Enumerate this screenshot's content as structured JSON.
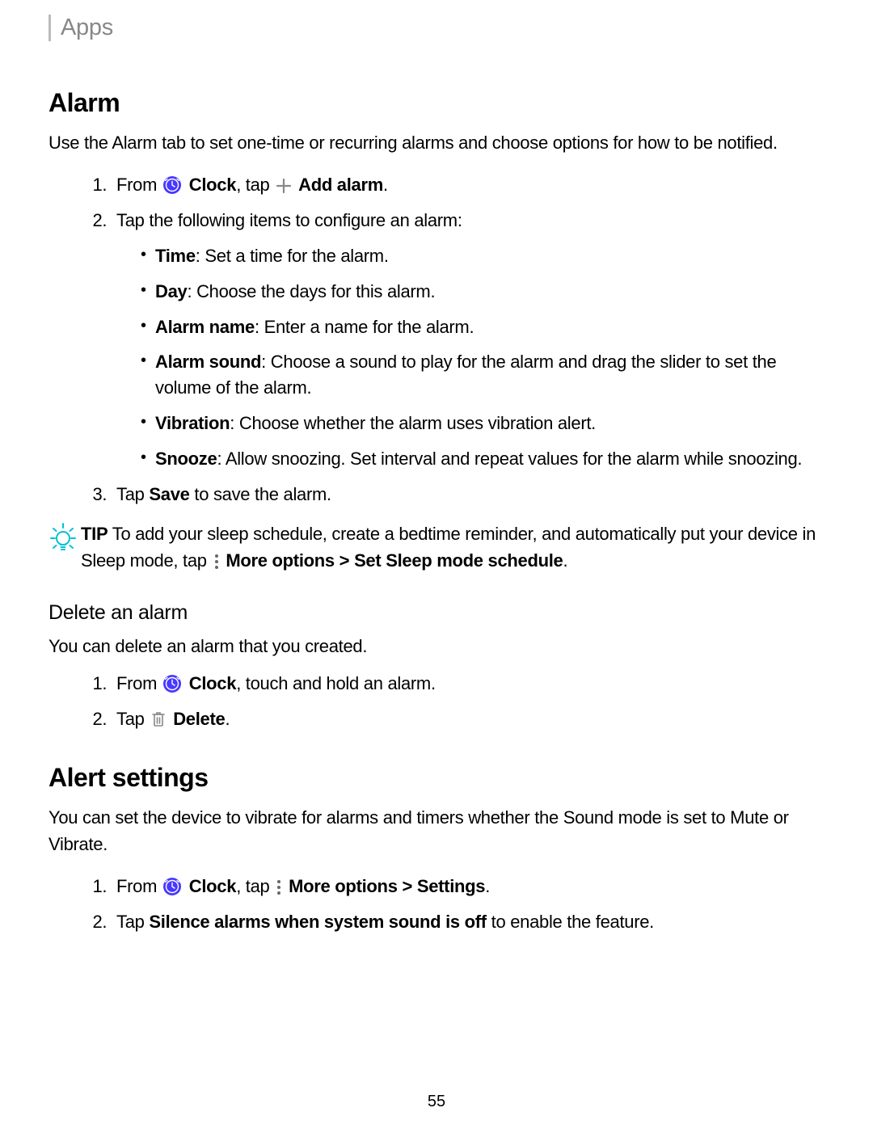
{
  "breadcrumb": "Apps",
  "page_number": "55",
  "alarm": {
    "heading": "Alarm",
    "intro": "Use the Alarm tab to set one-time or recurring alarms and choose options for how to be notified.",
    "step1": {
      "from": "From",
      "clock": "Clock",
      "tap": ", tap",
      "add_alarm": "Add alarm",
      "period": "."
    },
    "step2": {
      "lead": "Tap the following items to configure an alarm:",
      "items": [
        {
          "label": "Time",
          "desc": ": Set a time for the alarm."
        },
        {
          "label": "Day",
          "desc": ": Choose the days for this alarm."
        },
        {
          "label": "Alarm name",
          "desc": ": Enter a name for the alarm."
        },
        {
          "label": "Alarm sound",
          "desc": ": Choose a sound to play for the alarm and drag the slider to set the volume of the alarm."
        },
        {
          "label": "Vibration",
          "desc": ": Choose whether the alarm uses vibration alert."
        },
        {
          "label": "Snooze",
          "desc": ": Allow snoozing. Set interval and repeat values for the alarm while snoozing."
        }
      ]
    },
    "step3": {
      "pre": "Tap ",
      "save": "Save",
      "post": " to save the alarm."
    }
  },
  "tip": {
    "label": "TIP",
    "text1": "  To add your sleep schedule, create a bedtime reminder, and automatically put your device in Sleep mode, tap ",
    "more_options": "More options",
    "gt": " > ",
    "schedule": "Set Sleep mode schedule",
    "period": "."
  },
  "delete": {
    "heading": "Delete an alarm",
    "intro": "You can delete an alarm that you created.",
    "step1": {
      "from": "From",
      "clock": "Clock",
      "rest": ", touch and hold an alarm."
    },
    "step2": {
      "tap": "Tap ",
      "delete": "Delete",
      "period": "."
    }
  },
  "alert": {
    "heading": "Alert settings",
    "intro": "You can set the device to vibrate for alarms and timers whether the Sound mode is set to Mute or Vibrate.",
    "step1": {
      "from": "From",
      "clock": "Clock",
      "tap": ", tap",
      "more_options": "More options",
      "gt": " > ",
      "settings": "Settings",
      "period": "."
    },
    "step2": {
      "pre": "Tap ",
      "bold": "Silence alarms when system sound is off",
      "post": " to enable the feature."
    }
  }
}
